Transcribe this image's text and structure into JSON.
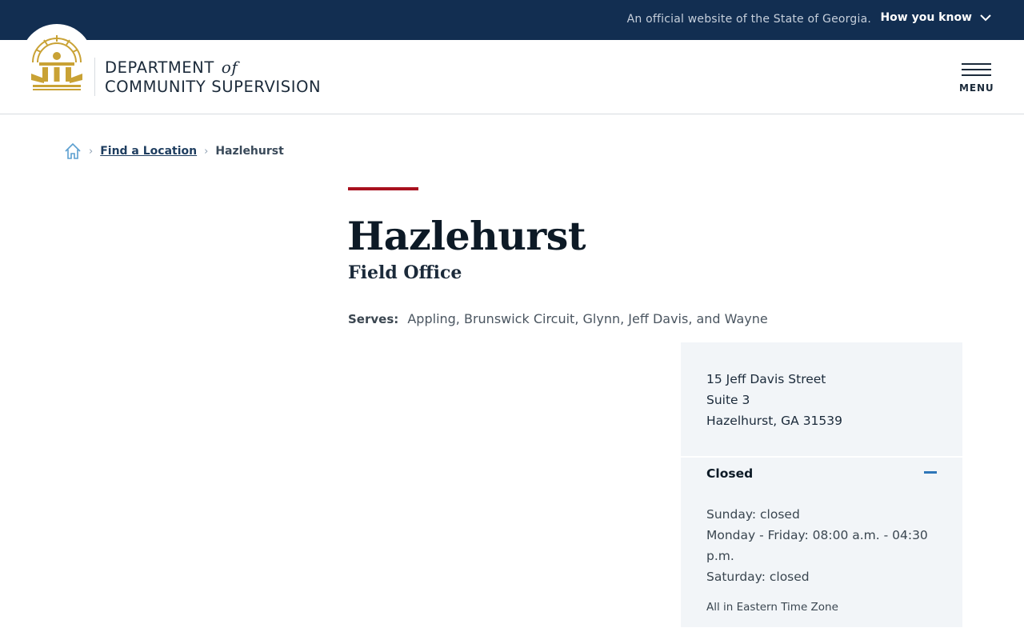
{
  "banner": {
    "official_text": "An official website of the State of Georgia.",
    "how_you_know": "How you know"
  },
  "header": {
    "logo_line1": "DEPARTMENT",
    "logo_of": "of",
    "logo_line2": "COMMUNITY SUPERVISION",
    "menu_label": "MENU"
  },
  "breadcrumb": {
    "home_icon": "home-icon",
    "items": [
      {
        "label": "Find a Location"
      },
      {
        "label": "Hazlehurst"
      }
    ]
  },
  "main": {
    "title": "Hazlehurst",
    "subtitle": "Field Office",
    "serves_label": "Serves:",
    "serves_value": "Appling, Brunswick Circuit, Glynn, Jeff Davis, and Wayne"
  },
  "card": {
    "address": [
      "15 Jeff Davis Street",
      "Suite 3",
      "Hazelhurst, GA 31539"
    ],
    "status": "Closed",
    "hours": [
      "Sunday: closed",
      "Monday - Friday: 08:00 a.m. - 04:30 p.m.",
      "Saturday: closed"
    ],
    "timezone": "All in Eastern Time Zone"
  },
  "colors": {
    "banner_bg": "#122e51",
    "accent_red": "#a8101e",
    "seal_gold": "#c9a235",
    "link": "#1e3d5f",
    "card_bg": "#f2f5f8",
    "toggle_blue": "#2e76b8"
  }
}
